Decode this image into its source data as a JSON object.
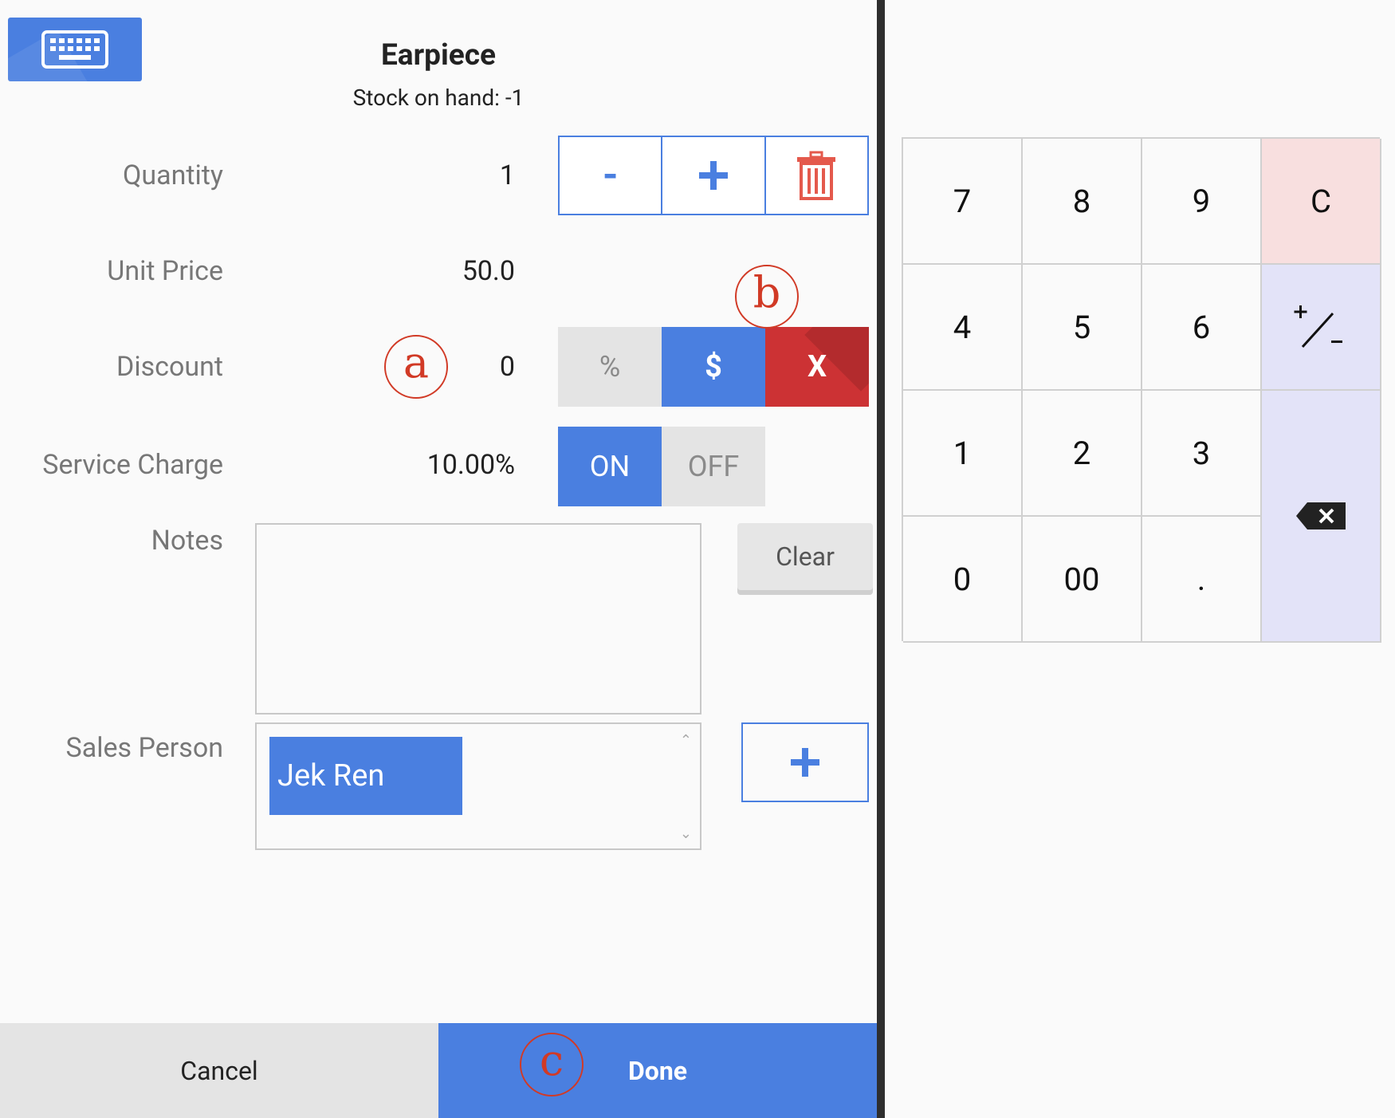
{
  "product": {
    "title": "Earpiece",
    "stock_label": "Stock on hand: -1"
  },
  "keyboard_toggle": {
    "icon": "keyboard-icon"
  },
  "quantity": {
    "label": "Quantity",
    "value": "1",
    "minus_label": "-",
    "plus_icon": "plus-icon",
    "delete_icon": "trash-icon"
  },
  "unit_price": {
    "label": "Unit Price",
    "value": "50.0"
  },
  "discount": {
    "label": "Discount",
    "value": "0",
    "percent_label": "%",
    "dollar_label": "$",
    "remove_label": "X",
    "selected": "$"
  },
  "service_charge": {
    "label": "Service Charge",
    "value": "10.00%",
    "on_label": "ON",
    "off_label": "OFF",
    "selected": "ON"
  },
  "notes": {
    "label": "Notes",
    "value": "",
    "clear_label": "Clear"
  },
  "sales_person": {
    "label": "Sales Person",
    "selected": [
      "Jek Ren"
    ],
    "add_icon": "plus-icon"
  },
  "footer": {
    "cancel_label": "Cancel",
    "done_label": "Done"
  },
  "annotations": [
    "a",
    "b",
    "c"
  ],
  "numpad": {
    "keys": [
      "7",
      "8",
      "9",
      "C",
      "4",
      "5",
      "6",
      "+/-",
      "1",
      "2",
      "3",
      "backspace",
      "0",
      "00",
      "."
    ]
  },
  "colors": {
    "accent": "#4a7fe0",
    "danger": "#cc3234",
    "annotation": "#d13a26",
    "clear_key": "#f8dfdf",
    "function_key": "#e3e3f8"
  }
}
